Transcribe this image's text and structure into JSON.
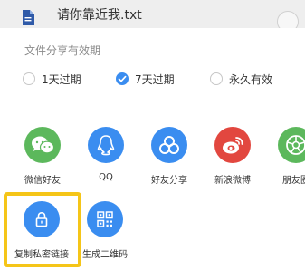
{
  "header": {
    "file_name": "请你靠近我.txt",
    "file_icon": "document-icon",
    "corner_icon": "close-icon"
  },
  "validity": {
    "title": "文件分享有效期",
    "options": [
      {
        "label": "1天过期",
        "checked": false
      },
      {
        "label": "7天过期",
        "checked": true
      },
      {
        "label": "永久有效",
        "checked": false
      }
    ]
  },
  "share_targets": [
    {
      "label": "微信好友",
      "icon": "wechat-icon",
      "color": "#5cb85c"
    },
    {
      "label": "QQ",
      "icon": "qq-icon",
      "color": "#3a8df0"
    },
    {
      "label": "好友分享",
      "icon": "friend-share-icon",
      "color": "#3a8df0"
    },
    {
      "label": "新浪微博",
      "icon": "weibo-icon",
      "color": "#e2473f"
    },
    {
      "label": "朋友圈",
      "icon": "moments-icon",
      "color": "#5cb85c"
    }
  ],
  "actions": [
    {
      "label": "复制私密链接",
      "icon": "lock-icon",
      "color": "#3a8df0",
      "highlighted": true
    },
    {
      "label": "生成二维码",
      "icon": "qr-code-icon",
      "color": "#3a8df0",
      "highlighted": false
    }
  ],
  "colors": {
    "accent": "#3a8df0",
    "highlight": "#f5c518"
  }
}
